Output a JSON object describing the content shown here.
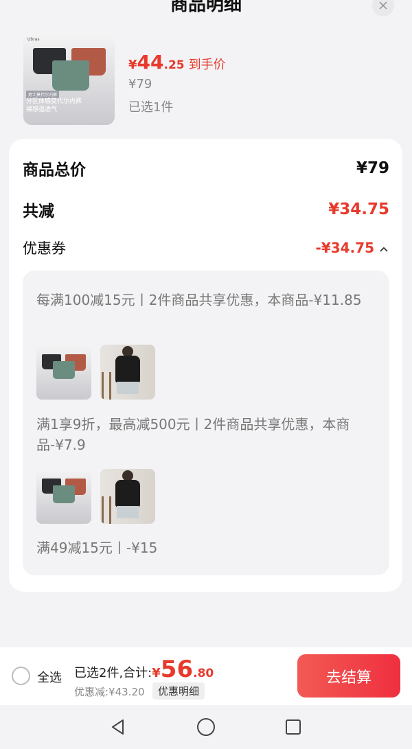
{
  "header": {
    "title": "商品明细"
  },
  "product": {
    "thumb_brand": "Ubras",
    "thumb_tag": "男士莫代尔内裤",
    "thumb_caption_1": "分区体感莫代尔内裤",
    "thumb_caption_2": "裸感强透气",
    "price_currency": "¥",
    "price_int": "44",
    "price_dec": ".25",
    "price_label": "到手价",
    "original_price": "¥79",
    "selected": "已选1件"
  },
  "summary": {
    "total_label": "商品总价",
    "total_value": "¥79",
    "discount_label": "共减",
    "discount_value": "¥34.75",
    "coupon_label": "优惠券",
    "coupon_value": "-¥34.75"
  },
  "coupons": [
    {
      "desc": "每满100减15元丨2件商品共享优惠，本商品-¥11.85"
    },
    {
      "desc": "满1享9折，最高减500元丨2件商品共享优惠，本商品-¥7.9"
    },
    {
      "desc": "满49减15元丨-¥15"
    }
  ],
  "bottom": {
    "select_all": "全选",
    "summary_text": "已选2件,合计:",
    "total_currency": "¥",
    "total_int": "56",
    "total_dec": ".80",
    "saved": "优惠减:¥43.20",
    "detail_button": "优惠明细",
    "checkout": "去结算"
  },
  "colors": {
    "accent": "#e73a2c",
    "checkout_bg": "#ef3b45"
  }
}
